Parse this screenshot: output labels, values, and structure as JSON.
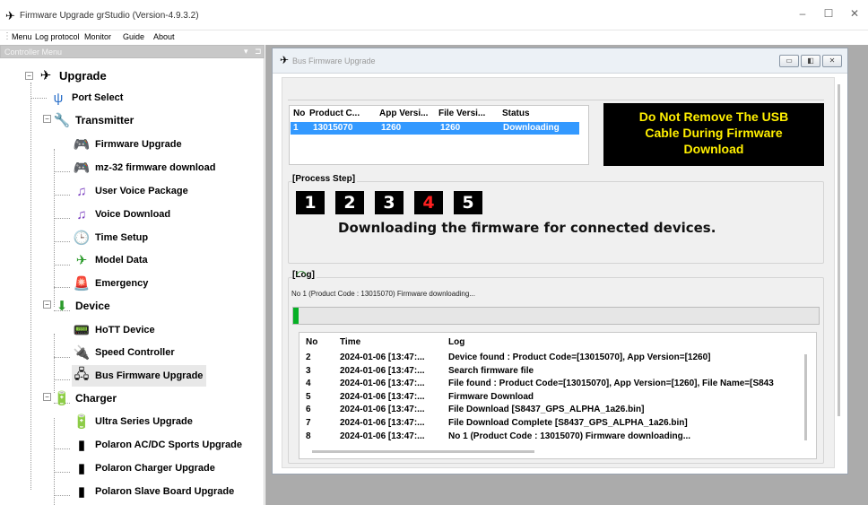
{
  "window": {
    "title": "Firmware Upgrade grStudio (Version-4.9.3.2)",
    "minimize": "–",
    "maximize": "☐",
    "close": "✕"
  },
  "menu": {
    "grip": "⋮",
    "items": [
      "Menu",
      "Log protocol",
      "Monitor",
      "Guide",
      "About"
    ]
  },
  "sidebar": {
    "panel_title": "Controller Menu",
    "pin": "▾",
    "pin2": "⊐",
    "root": "Upgrade",
    "port_select": "Port Select",
    "transmitter": "Transmitter",
    "transmitter_items": [
      "Firmware Upgrade",
      "mz-32 firmware download",
      "User Voice Package",
      "Voice Download",
      "Time Setup",
      "Model Data",
      "Emergency"
    ],
    "device": "Device",
    "device_items": [
      "HoTT Device",
      "Speed Controller",
      "Bus Firmware Upgrade"
    ],
    "charger": "Charger",
    "charger_items": [
      "Ultra Series Upgrade",
      "Polaron AC/DC Sports Upgrade",
      "Polaron Charger Upgrade",
      "Polaron Slave Board Upgrade"
    ],
    "expander_open": "−"
  },
  "child_window": {
    "title": "Bus Firmware Upgrade",
    "buttons": [
      "▭",
      "◧",
      "✕"
    ]
  },
  "device_table": {
    "headers": [
      "No",
      "Product C...",
      "App Versi...",
      "File Versi...",
      "Status"
    ],
    "rows": [
      [
        "1",
        "13015070",
        "1260",
        "1260",
        "Downloading"
      ]
    ]
  },
  "warning": {
    "line1": "Do Not Remove The USB",
    "line2": "Cable During Firmware",
    "line3": "Download",
    "bg_color": "#000000",
    "text_color": "#ffef00"
  },
  "process": {
    "legend": "[Process Step]",
    "steps": [
      "1",
      "2",
      "3",
      "4",
      "5"
    ],
    "active_step": 4,
    "message": "Downloading the firmware for connected devices."
  },
  "log": {
    "legend": "[Log]",
    "status": "No 1 (Product Code : 13015070) Firmware downloading...",
    "progress": 0.01,
    "headers": [
      "No",
      "Time",
      "Log"
    ],
    "rows": [
      [
        "2",
        "2024-01-06 [13:47:...",
        "Device found : Product Code=[13015070], App Version=[1260]"
      ],
      [
        "3",
        "2024-01-06 [13:47:...",
        "Search firmware file"
      ],
      [
        "4",
        "2024-01-06 [13:47:...",
        "File found : Product Code=[13015070], App Version=[1260], File Name=[S843"
      ],
      [
        "5",
        "2024-01-06 [13:47:...",
        "Firmware Download"
      ],
      [
        "6",
        "2024-01-06 [13:47:...",
        "File Download [S8437_GPS_ALPHA_1a26.bin]"
      ],
      [
        "7",
        "2024-01-06 [13:47:...",
        "File Download Complete [S8437_GPS_ALPHA_1a26.bin]"
      ],
      [
        "8",
        "2024-01-06 [13:47:...",
        "No 1 (Product Code : 13015070) Firmware downloading..."
      ]
    ]
  }
}
